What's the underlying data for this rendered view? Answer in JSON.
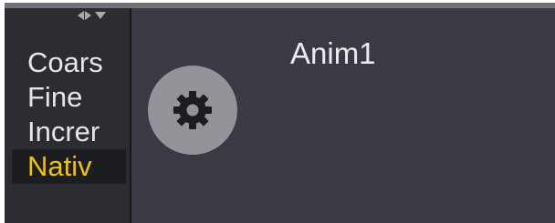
{
  "list": {
    "items": [
      {
        "label": "Coars",
        "selected": false
      },
      {
        "label": "Fine",
        "selected": false
      },
      {
        "label": "Increr",
        "selected": false
      },
      {
        "label": "Nativ",
        "selected": true
      }
    ]
  },
  "panel": {
    "title": "Anim1",
    "gear_icon": "gear-icon"
  },
  "colors": {
    "selected_text": "#f2c200",
    "panel_bg": "#3a3a42",
    "left_bg": "#2c2d32",
    "gear_bg": "#93949a"
  }
}
